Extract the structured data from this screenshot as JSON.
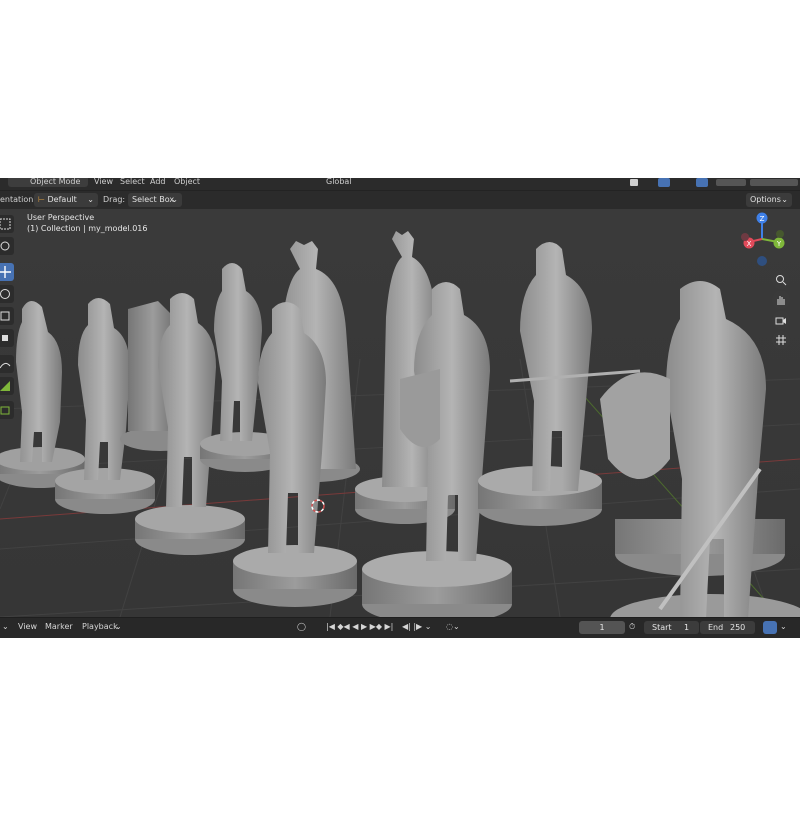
{
  "header": {
    "mode": "Object Mode",
    "menus": [
      "View",
      "Select",
      "Add",
      "Object"
    ],
    "transform_orientation": "Global"
  },
  "tool_settings": {
    "orientation_label": "entation:",
    "orientation_value": "Default",
    "drag_label": "Drag:",
    "drag_value": "Select Box",
    "options_label": "Options"
  },
  "viewport": {
    "perspective_label": "User Perspective",
    "collection_label": "(1) Collection | my_model.016",
    "gizmo": {
      "z": "Z",
      "x": "X",
      "y": "Y"
    },
    "colors": {
      "x_axis": "#e04a5a",
      "y_axis": "#7fb73a",
      "z_axis": "#3f80e8",
      "active_tool": "#4772b3"
    }
  },
  "timeline": {
    "menus": [
      "View",
      "Marker",
      "Playback"
    ],
    "current_frame": "1",
    "start_label": "Start",
    "start_value": "1",
    "end_label": "End",
    "end_value": "250"
  },
  "icons": [
    "select-box-icon",
    "cursor-icon",
    "move-icon",
    "rotate-icon",
    "scale-icon",
    "transform-icon",
    "annotate-icon",
    "measure-icon",
    "add-cube-icon",
    "zoom-icon",
    "hand-pan-icon",
    "camera-icon",
    "grid-icon"
  ]
}
